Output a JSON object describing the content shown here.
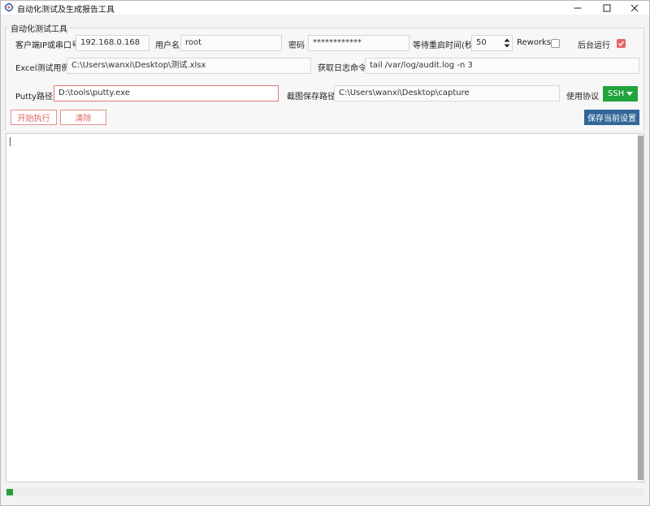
{
  "window": {
    "title": "自动化测试及生成报告工具",
    "app_icon": "gear-bug-icon",
    "minimize_icon": "minimize-icon",
    "maximize_icon": "maximize-icon",
    "close_icon": "close-icon"
  },
  "group": {
    "title": "自动化测试工具"
  },
  "row1": {
    "client_label": "客户端IP或串口号",
    "client_value": "192.168.0.168",
    "user_label": "用户名",
    "user_value": "root",
    "password_label": "密码",
    "password_value": "************",
    "wait_label": "等待重启时间(秒)",
    "wait_value": "50",
    "reworks_label": "Reworks",
    "reworks_checked": false,
    "background_label": "后台运行",
    "background_checked": true
  },
  "row2": {
    "excel_label": "Excel测试用例",
    "excel_value": "C:\\Users\\wanxi\\Desktop\\测试.xlsx",
    "log_cmd_label": "获取日志命令",
    "log_cmd_value": "tail /var/log/audit.log -n 3"
  },
  "row3": {
    "putty_label": "Putty路径",
    "putty_value": "D:\\tools\\putty.exe",
    "capture_label": "截图保存路径",
    "capture_value": "C:\\Users\\wanxi\\Desktop\\capture",
    "protocol_label": "使用协议",
    "protocol_value": "SSH"
  },
  "actions": {
    "start_label": "开始执行",
    "clear_label": "清除",
    "save_label": "保存当前设置"
  },
  "output": {
    "text": ""
  },
  "progress": {
    "fraction": 0.01
  },
  "colors": {
    "accent_red": "#e0665f",
    "checkbox_checked": "#e86565",
    "primary_blue": "#336699",
    "ssh_green": "#22a33d",
    "progress_green": "#2a9d3b"
  }
}
